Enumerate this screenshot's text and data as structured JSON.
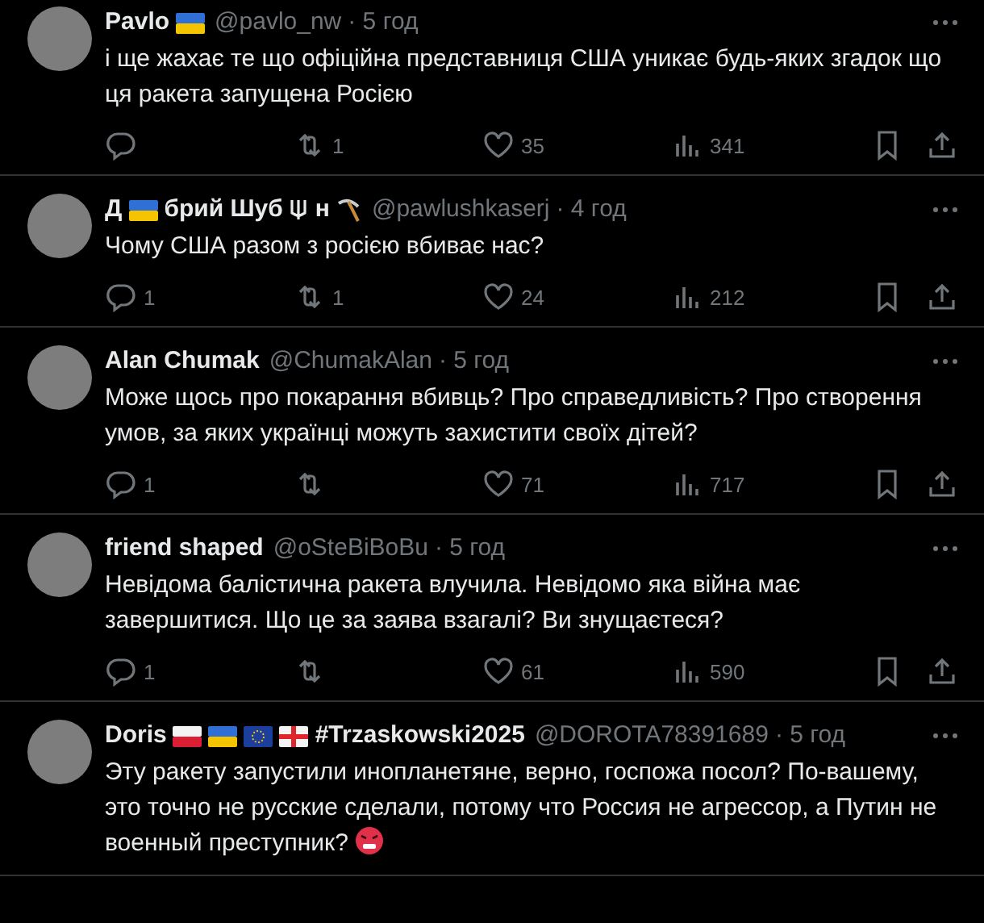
{
  "tweets": [
    {
      "name": [
        {
          "kind": "text",
          "text": "Pavlo"
        },
        {
          "kind": "uaflag"
        }
      ],
      "handle": "@pavlo_nw",
      "time": "· 5 год",
      "body": [
        {
          "kind": "text",
          "text": "і ще жахає те що офіційна представниця США уникає будь-яких згадок що ця ракета запущена Росією"
        }
      ],
      "actions": {
        "reposts": "1",
        "likes": "35",
        "views": "341"
      }
    },
    {
      "name": [
        {
          "kind": "text",
          "text": "Д"
        },
        {
          "kind": "uaflag"
        },
        {
          "kind": "text",
          "text": "брий Шуб"
        },
        {
          "kind": "trident"
        },
        {
          "kind": "text",
          "text": "н"
        },
        {
          "kind": "pickaxe"
        }
      ],
      "handle": "@pawlushkaserj",
      "time": "· 4 год",
      "body": [
        {
          "kind": "text",
          "text": "Чому США разом з росією вбиває нас?"
        }
      ],
      "actions": {
        "replies": "1",
        "reposts": "1",
        "likes": "24",
        "views": "212"
      }
    },
    {
      "name": [
        {
          "kind": "text",
          "text": "Alan Chumak"
        }
      ],
      "handle": "@ChumakAlan",
      "time": "· 5 год",
      "body": [
        {
          "kind": "text",
          "text": "Може щось про покарання вбивць? Про справедливість? Про створення умов, за яких українці можуть захистити своїх дітей?"
        }
      ],
      "actions": {
        "replies": "1",
        "likes": "71",
        "views": "717"
      }
    },
    {
      "name": [
        {
          "kind": "text",
          "text": "friend shaped"
        }
      ],
      "handle": "@oSteBiBoBu",
      "time": "· 5 год",
      "body": [
        {
          "kind": "text",
          "text": "Невідома балістична ракета влучила. Невідомо яка війна має завершитися. Що це за заява взагалі? Ви знущаєтеся?"
        }
      ],
      "actions": {
        "replies": "1",
        "likes": "61",
        "views": "590"
      }
    },
    {
      "name": [
        {
          "kind": "text",
          "text": "Doris"
        },
        {
          "kind": "plflag"
        },
        {
          "kind": "uaflag"
        },
        {
          "kind": "euflag"
        },
        {
          "kind": "geflag"
        },
        {
          "kind": "text",
          "text": "#Trzaskowski2025"
        }
      ],
      "handle": "@DOROTA78391689",
      "time": "· 5 год",
      "body": [
        {
          "kind": "text",
          "text": "Эту ракету запустили инопланетяне, верно, госпожа посол? По-вашему, это точно не русские сделали, потому что Россия не агрессор, а Путин не военный преступник? "
        },
        {
          "kind": "emoji"
        }
      ]
    }
  ]
}
